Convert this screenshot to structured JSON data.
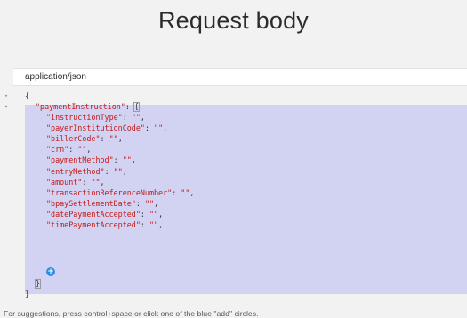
{
  "header": {
    "title": "Request body"
  },
  "content_type": {
    "value": "application/json"
  },
  "editor": {
    "open_brace": "{",
    "close_brace": "}",
    "root_key": "\"paymentInstruction\"",
    "colon": ": ",
    "inner_open": "{",
    "inner_close": "}",
    "fields": [
      {
        "key": "\"instructionType\"",
        "value": "\"\""
      },
      {
        "key": "\"payerInstitutionCode\"",
        "value": "\"\""
      },
      {
        "key": "\"billerCode\"",
        "value": "\"\""
      },
      {
        "key": "\"crn\"",
        "value": "\"\""
      },
      {
        "key": "\"paymentMethod\"",
        "value": "\"\""
      },
      {
        "key": "\"entryMethod\"",
        "value": "\"\""
      },
      {
        "key": "\"amount\"",
        "value": "\"\""
      },
      {
        "key": "\"transactionReferenceNumber\"",
        "value": "\"\""
      },
      {
        "key": "\"bpaySettlementDate\"",
        "value": "\"\""
      },
      {
        "key": "\"datePaymentAccepted\"",
        "value": "\"\""
      },
      {
        "key": "\"timePaymentAccepted\"",
        "value": "\"\""
      }
    ],
    "fold_arrow_icon": "caret-down-icon",
    "add_icon": "add-circle-icon",
    "selection_color": "#d2d2f3",
    "string_color": "#c41a16",
    "add_color": "#2a8fe0"
  },
  "footer": {
    "hint": "For suggestions, press control+space or click one of the blue \"add\" circles."
  }
}
